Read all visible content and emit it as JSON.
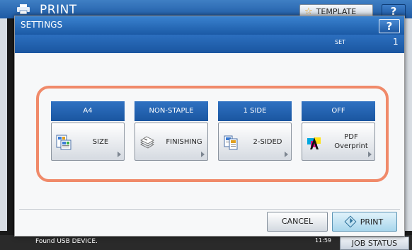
{
  "background": {
    "title": "PRINT",
    "template_label": "TEMPLATE",
    "help_label": "?",
    "status_message": "Found USB DEVICE.",
    "time": "11:59",
    "job_status_label": "JOB STATUS"
  },
  "dialog": {
    "title": "SETTINGS",
    "help_label": "?",
    "set_label": "SET",
    "set_value": "1",
    "functions": [
      {
        "status": "A4",
        "label": "SIZE",
        "icon": "paper-size-icon"
      },
      {
        "status": "NON-STAPLE",
        "label": "FINISHING",
        "icon": "finishing-icon"
      },
      {
        "status": "1 SIDE",
        "label": "2-SIDED",
        "icon": "duplex-icon"
      },
      {
        "status": "OFF",
        "label": "PDF Overprint",
        "icon": "pdf-overprint-icon"
      }
    ],
    "cancel_label": "CANCEL",
    "print_label": "PRINT"
  },
  "colors": {
    "header_blue": "#1b5aa6",
    "panel_border": "#f08a6a",
    "print_button": "#a8d6ec"
  }
}
